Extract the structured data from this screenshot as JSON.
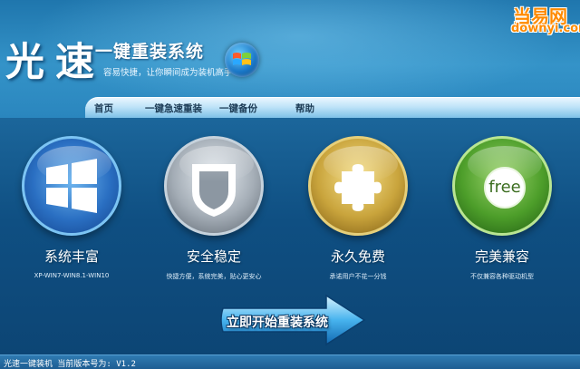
{
  "header": {
    "brand_big": "光速",
    "brand_sub": "一键重装系统",
    "slogan": "容易快捷，让你瞬间成为装机高手",
    "logo_main": "当易网",
    "logo_sub": "downyi.com"
  },
  "nav": {
    "items": [
      {
        "label": "首页"
      },
      {
        "label": "一键急速重装"
      },
      {
        "label": "一键备份"
      },
      {
        "label": "帮助"
      }
    ]
  },
  "features": [
    {
      "title": "系统丰富",
      "desc": "XP-WIN7-WIN8.1-WIN10",
      "icon": "windows-logo-icon"
    },
    {
      "title": "安全稳定",
      "desc": "快捷方便，系统完美，贴心更安心",
      "icon": "shield-icon"
    },
    {
      "title": "永久免费",
      "desc": "承诺用户不花一分钱",
      "icon": "puzzle-icon"
    },
    {
      "title": "完美兼容",
      "desc": "不仅兼容各种驱动机型",
      "icon": "free-badge-icon",
      "badge": "free"
    }
  ],
  "start_button": {
    "label": "立即开始重装系统"
  },
  "status": {
    "text": "光速一键装机 当前版本号为: V1.2"
  },
  "colors": {
    "background": "#12507e",
    "nav": "#bfe3f8",
    "logo": "#ff8a00"
  }
}
